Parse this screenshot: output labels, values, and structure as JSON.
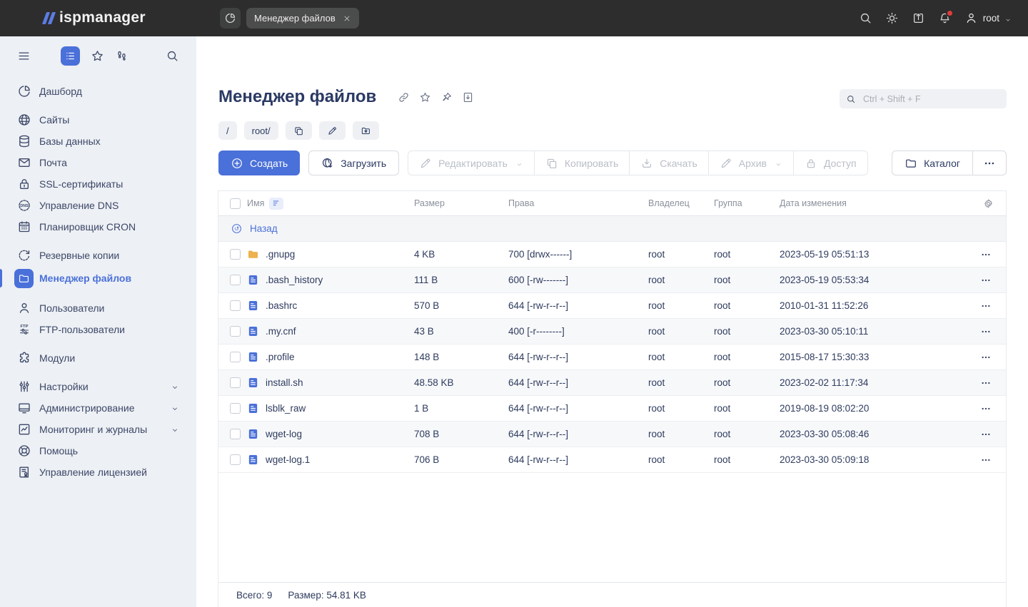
{
  "colors": {
    "accent": "#4a70d9",
    "topbar": "#2d2d2d",
    "sidebar_bg": "#edf0f4",
    "folder": "#edb14d",
    "file": "#4a70d9",
    "notification": "#e03b3b"
  },
  "topbar": {
    "logo": "ispmanager",
    "dashboard_icon": "pie-chart-icon",
    "tab": {
      "label": "Менеджер файлов",
      "close_icon": "close-icon"
    },
    "right_icons": [
      "search-icon",
      "sun-icon",
      "export-icon",
      "bell-icon"
    ],
    "user": {
      "name": "root",
      "icon": "user-icon"
    }
  },
  "sidebar": {
    "top_icons": [
      "hamburger-icon",
      "list-view-icon",
      "star-icon",
      "footsteps-icon",
      "search-icon"
    ],
    "sections": [
      {
        "items": [
          {
            "label": "Дашборд",
            "icon": "pie-chart-icon"
          }
        ]
      },
      {
        "items": [
          {
            "label": "Сайты",
            "icon": "globe-icon"
          },
          {
            "label": "Базы данных",
            "icon": "database-icon"
          },
          {
            "label": "Почта",
            "icon": "mail-icon"
          },
          {
            "label": "SSL-сертификаты",
            "icon": "ssl-lock-icon"
          },
          {
            "label": "Управление DNS",
            "icon": "dns-icon"
          },
          {
            "label": "Планировщик CRON",
            "icon": "calendar-icon"
          }
        ]
      },
      {
        "items": [
          {
            "label": "Резервные копии",
            "icon": "backup-icon"
          },
          {
            "label": "Менеджер файлов",
            "icon": "folder-icon",
            "active": true
          }
        ]
      },
      {
        "items": [
          {
            "label": "Пользователи",
            "icon": "user-icon"
          },
          {
            "label": "FTP-пользователи",
            "icon": "ftp-icon"
          }
        ]
      },
      {
        "items": [
          {
            "label": "Модули",
            "icon": "puzzle-icon"
          }
        ]
      },
      {
        "items": [
          {
            "label": "Настройки",
            "icon": "sliders-icon",
            "chevron": true
          },
          {
            "label": "Администрирование",
            "icon": "monitor-icon",
            "chevron": true
          },
          {
            "label": "Мониторинг и журналы",
            "icon": "chart-icon",
            "chevron": true
          },
          {
            "label": "Помощь",
            "icon": "lifebuoy-icon"
          },
          {
            "label": "Управление лицензией",
            "icon": "license-icon"
          }
        ]
      }
    ]
  },
  "page": {
    "title": "Менеджер файлов",
    "title_actions": [
      "link-icon",
      "star-icon",
      "pin-icon",
      "doc-download-icon"
    ],
    "search_placeholder": "Ctrl + Shift + F",
    "breadcrumb": {
      "root_chip": "/",
      "path_chip": "root/",
      "action_icons": [
        "copy-icon",
        "pencil-icon",
        "folder-star-icon"
      ]
    }
  },
  "toolbar": {
    "create": {
      "label": "Создать",
      "icon": "plus-circle-icon"
    },
    "upload": {
      "label": "Загрузить",
      "icon": "upload-icon"
    },
    "disabled_group": [
      {
        "label": "Редактировать",
        "icon": "pencil-icon",
        "chevron": true
      },
      {
        "label": "Копировать",
        "icon": "copy-icon"
      },
      {
        "label": "Скачать",
        "icon": "download-icon"
      },
      {
        "label": "Архив",
        "icon": "archive-icon",
        "chevron": true
      },
      {
        "label": "Доступ",
        "icon": "lock-icon"
      }
    ],
    "catalog": {
      "label": "Каталог",
      "icon": "folder-icon"
    },
    "more_icon": "ellipsis-icon"
  },
  "table": {
    "headers": {
      "name": "Имя",
      "size": "Размер",
      "perms": "Права",
      "owner": "Владелец",
      "group": "Группа",
      "date": "Дата изменения"
    },
    "sort_icon": "sort-icon",
    "settings_icon": "gear-icon",
    "back_row": {
      "label": "Назад",
      "icon": "history-back-icon"
    },
    "rows": [
      {
        "icon": "folder-fill-icon",
        "name": ".gnupg",
        "size": "4 KB",
        "perms": "700 [drwx------]",
        "owner": "root",
        "group": "root",
        "date": "2023-05-19 05:51:13"
      },
      {
        "icon": "file-icon",
        "name": ".bash_history",
        "size": "111 B",
        "perms": "600 [-rw-------]",
        "owner": "root",
        "group": "root",
        "date": "2023-05-19 05:53:34"
      },
      {
        "icon": "file-icon",
        "name": ".bashrc",
        "size": "570 B",
        "perms": "644 [-rw-r--r--]",
        "owner": "root",
        "group": "root",
        "date": "2010-01-31 11:52:26"
      },
      {
        "icon": "file-icon",
        "name": ".my.cnf",
        "size": "43 B",
        "perms": "400 [-r--------]",
        "owner": "root",
        "group": "root",
        "date": "2023-03-30 05:10:11"
      },
      {
        "icon": "file-icon",
        "name": ".profile",
        "size": "148 B",
        "perms": "644 [-rw-r--r--]",
        "owner": "root",
        "group": "root",
        "date": "2015-08-17 15:30:33"
      },
      {
        "icon": "file-icon",
        "name": "install.sh",
        "size": "48.58 KB",
        "perms": "644 [-rw-r--r--]",
        "owner": "root",
        "group": "root",
        "date": "2023-02-02 11:17:34"
      },
      {
        "icon": "file-icon",
        "name": "lsblk_raw",
        "size": "1 B",
        "perms": "644 [-rw-r--r--]",
        "owner": "root",
        "group": "root",
        "date": "2019-08-19 08:02:20"
      },
      {
        "icon": "file-icon",
        "name": "wget-log",
        "size": "708 B",
        "perms": "644 [-rw-r--r--]",
        "owner": "root",
        "group": "root",
        "date": "2023-03-30 05:08:46"
      },
      {
        "icon": "file-icon",
        "name": "wget-log.1",
        "size": "706 B",
        "perms": "644 [-rw-r--r--]",
        "owner": "root",
        "group": "root",
        "date": "2023-03-30 05:09:18"
      }
    ]
  },
  "footer": {
    "total": "Всего: 9",
    "size": "Размер: 54.81 KB"
  }
}
